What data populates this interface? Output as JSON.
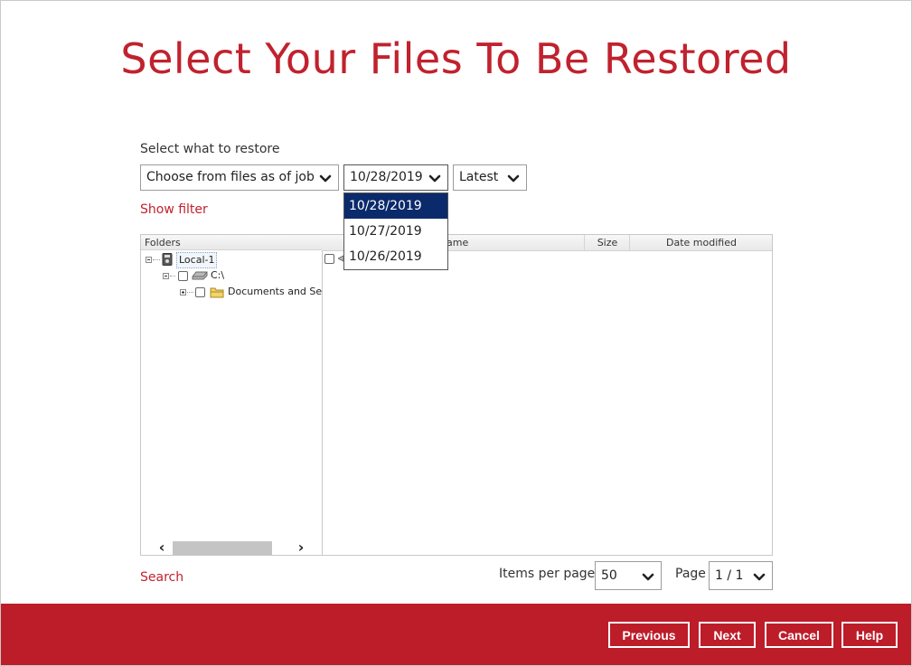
{
  "page": {
    "title": "Select Your Files To Be Restored"
  },
  "restore": {
    "label": "Select what to restore",
    "mode_value": "Choose from files as of job",
    "date_value": "10/28/2019",
    "version_value": "Latest",
    "date_options": [
      "10/28/2019",
      "10/27/2019",
      "10/26/2019"
    ]
  },
  "filter": {
    "show_filter_label": "Show filter"
  },
  "tree": {
    "header": "Folders",
    "nodes": [
      {
        "label": "Local-1"
      },
      {
        "label": "C:\\"
      },
      {
        "label": "Documents and Se"
      }
    ]
  },
  "files": {
    "col_name": "Name",
    "col_name_visible": "ame",
    "col_size": "Size",
    "col_date": "Date modified"
  },
  "search": {
    "label": "Search"
  },
  "pager": {
    "items_per_page_label": "Items per page",
    "items_per_page_value": "50",
    "page_label": "Page",
    "page_value": "1 / 1"
  },
  "footer": {
    "previous": "Previous",
    "next": "Next",
    "cancel": "Cancel",
    "help": "Help"
  },
  "colors": {
    "brand_red": "#bd1c29",
    "title_red": "#c0222e",
    "selected_blue": "#0b2a6b"
  }
}
